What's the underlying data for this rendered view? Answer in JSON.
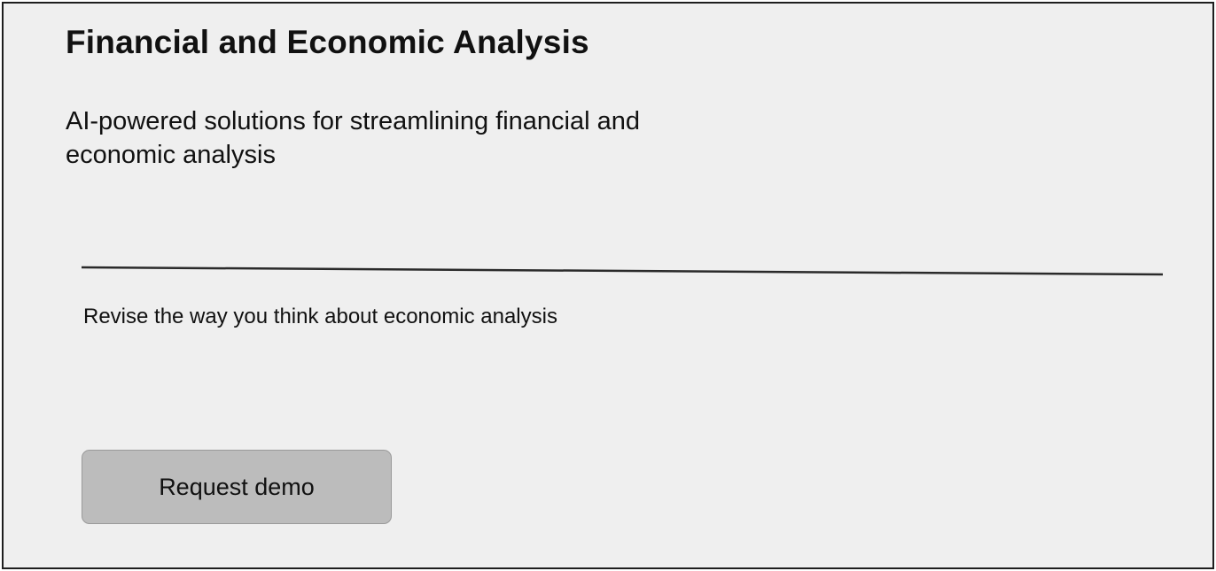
{
  "hero": {
    "title": "Financial and Economic Analysis",
    "subtitle": "AI-powered solutions for streamlining financial and economic analysis",
    "tagline": "Revise the way you think about economic analysis",
    "cta_label": "Request demo"
  },
  "colors": {
    "card_background": "#efefef",
    "border": "#1e1e1e",
    "button_background": "#bcbcbc",
    "text": "#111111"
  }
}
